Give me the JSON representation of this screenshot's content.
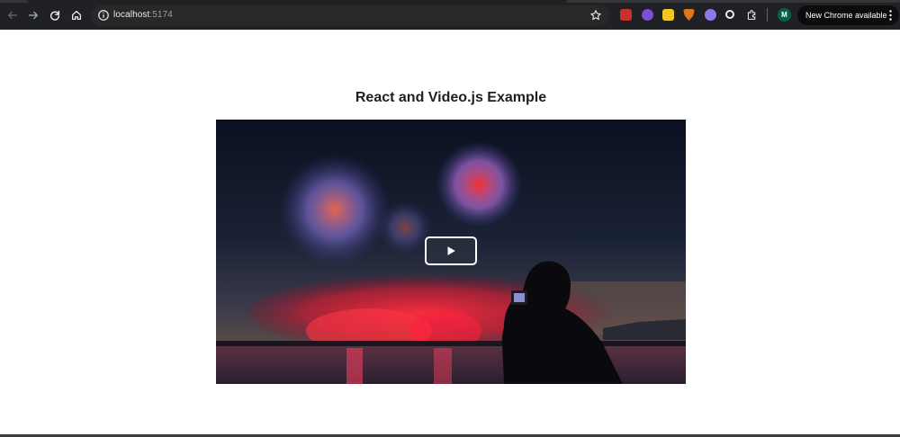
{
  "browser": {
    "url_host": "localhost",
    "url_port": ":5174",
    "profile_initial": "M",
    "update_button_label": "New Chrome available",
    "icons": [
      "back-icon",
      "forward-icon",
      "reload-icon",
      "home-icon",
      "site-info-icon",
      "bookmark-star-icon",
      "kebab-menu-icon"
    ],
    "extensions": [
      "extension-red-icon",
      "extension-purple-icon",
      "extension-yellow-icon",
      "extension-fox-icon",
      "extension-blue-icon",
      "extension-dark-icon",
      "extensions-puzzle-icon"
    ]
  },
  "page": {
    "title": "React and Video.js Example"
  },
  "video": {
    "big_play_button": "play-icon",
    "colors": {
      "control_bg": "#2b333f",
      "control_border": "#ffffff"
    }
  }
}
